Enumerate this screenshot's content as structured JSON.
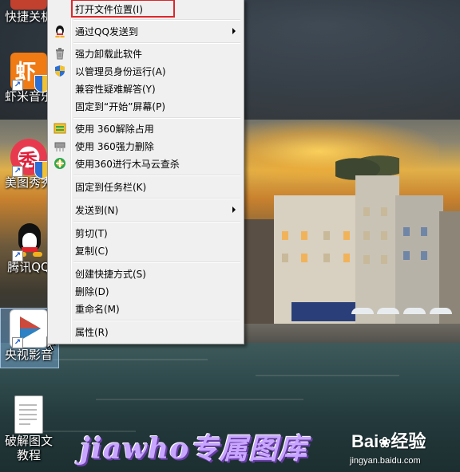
{
  "desktop": {
    "icons": [
      {
        "label": "快捷关机"
      },
      {
        "label": "虾米音乐"
      },
      {
        "label": "美图秀秀"
      },
      {
        "label": "腾讯QQ"
      },
      {
        "label": "央视影音"
      },
      {
        "label_line1": "破解图文",
        "label_line2": "教程"
      }
    ]
  },
  "context_menu": {
    "items": [
      {
        "label": "打开文件位置(I)",
        "icon": "none",
        "highlighted": true
      },
      {
        "label": "通过QQ发送到",
        "icon": "qq-penguin-icon",
        "submenu": true
      },
      {
        "label": "强力卸载此软件",
        "icon": "trash-icon"
      },
      {
        "label": "以管理员身份运行(A)",
        "icon": "uac-shield-icon"
      },
      {
        "label": "兼容性疑难解答(Y)",
        "icon": "none"
      },
      {
        "label": "固定到“开始”屏幕(P)",
        "icon": "none"
      },
      {
        "label": "使用 360解除占用",
        "icon": "360-unlock-icon"
      },
      {
        "label": "使用 360强力删除",
        "icon": "360-shredder-icon"
      },
      {
        "label": "使用360进行木马云查杀",
        "icon": "360-scan-icon"
      },
      {
        "label": "固定到任务栏(K)",
        "icon": "none"
      },
      {
        "label": "发送到(N)",
        "icon": "none",
        "submenu": true
      },
      {
        "label": "剪切(T)",
        "icon": "none"
      },
      {
        "label": "复制(C)",
        "icon": "none"
      },
      {
        "label": "创建快捷方式(S)",
        "icon": "none"
      },
      {
        "label": "删除(D)",
        "icon": "none"
      },
      {
        "label": "重命名(M)",
        "icon": "none"
      },
      {
        "label": "属性(R)",
        "icon": "none"
      }
    ]
  },
  "watermarks": {
    "author": "jiawho专属图库",
    "baidu_brand": "Bai",
    "baidu_brand_suffix": "经验",
    "baidu_url": "jingyan.baidu.com"
  },
  "colors": {
    "highlight_border": "#e0262a",
    "menu_bg": "#f0f0f0"
  }
}
